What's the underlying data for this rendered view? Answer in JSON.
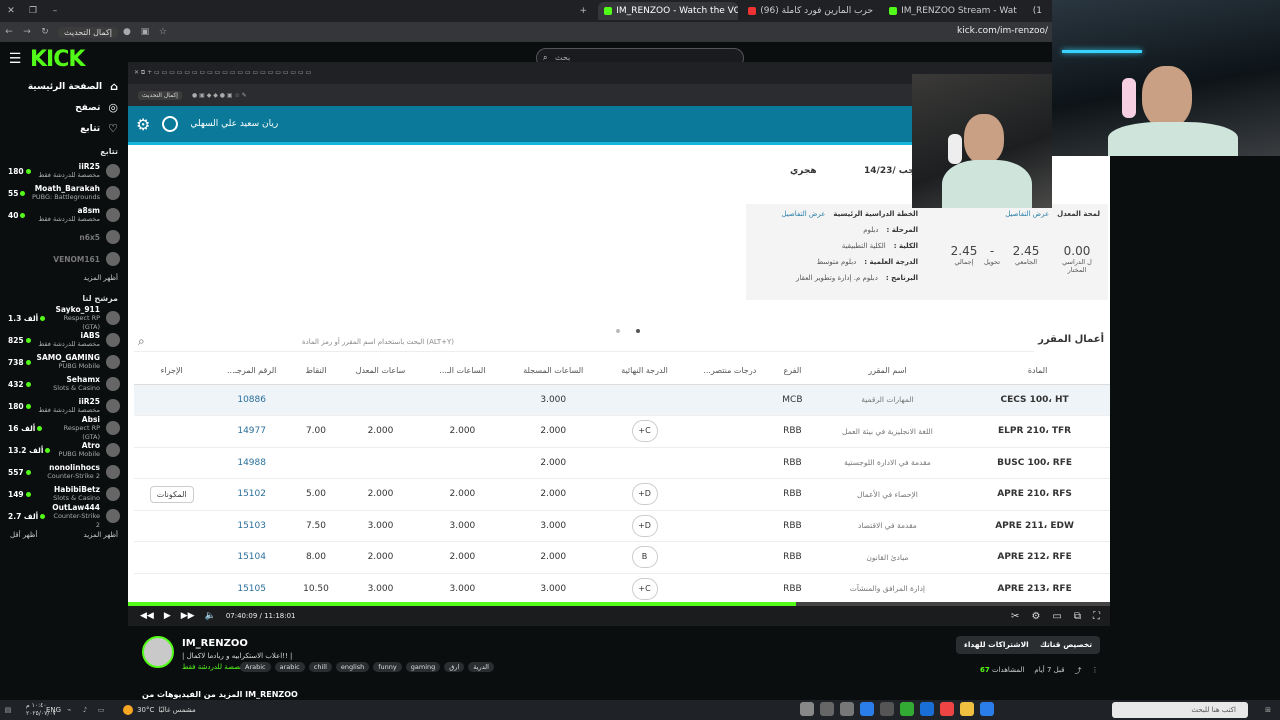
{
  "browser": {
    "tabs": [
      {
        "label": "IM_RENZOO - Watch the VOD",
        "active": true
      },
      {
        "label": "(96) حرب المارين فورد كاملة"
      },
      {
        "label": "IM_RENZOO Stream - Wat"
      },
      {
        "label": "(1"
      }
    ],
    "update_button": "إكمال التحديث",
    "url": "kick.com/im-renzoo/"
  },
  "kick": {
    "logo": "KICK",
    "search_placeholder": "بحث"
  },
  "sidebar": {
    "nav": [
      {
        "label": "الصفحة الرئيسية",
        "icon": "home-icon"
      },
      {
        "label": "تصفح",
        "icon": "compass-icon"
      },
      {
        "label": "تتابع",
        "icon": "heart-icon"
      }
    ],
    "following_title": "تتابع",
    "following": [
      {
        "name": "iiR25",
        "game": "مخصصة للدردشة فقط",
        "viewers": "180"
      },
      {
        "name": "Moath_Barakah",
        "game": "PUBG: Battlegrounds",
        "viewers": "55"
      },
      {
        "name": "a8sm",
        "game": "مخصصة للدردشة فقط",
        "viewers": "40"
      },
      {
        "name": "n6x5",
        "game": "",
        "viewers": "",
        "offline": true
      },
      {
        "name": "VENOM161",
        "game": "",
        "viewers": "",
        "offline": true
      }
    ],
    "show_more_1": "أظهر المزيد",
    "recommended_title": "مرشح لنا",
    "recommended": [
      {
        "name": "Sayko_911",
        "game": "Respect RP (GTA)",
        "viewers": "1.3 ألف"
      },
      {
        "name": "iABS",
        "game": "مخصصة للدردشة فقط",
        "viewers": "825"
      },
      {
        "name": "SAMO_GAMING",
        "game": "PUBG Mobile",
        "viewers": "738"
      },
      {
        "name": "Sehamx",
        "game": "Slots & Casino",
        "viewers": "432"
      },
      {
        "name": "iiR25",
        "game": "مخصصة للدردشة فقط",
        "viewers": "180"
      },
      {
        "name": "Absi",
        "game": "Respect RP (GTA)",
        "viewers": "16 ألف"
      },
      {
        "name": "Atro",
        "game": "PUBG Mobile",
        "viewers": "13.2 ألف"
      },
      {
        "name": "nonolinhocs",
        "game": "Counter-Strike 2",
        "viewers": "557"
      },
      {
        "name": "HabibiBetz",
        "game": "Slots & Casino",
        "viewers": "149"
      },
      {
        "name": "OutLaw444",
        "game": "Counter-Strike 2",
        "viewers": "2.7 ألف"
      }
    ],
    "show_more_2": "أظهر المزيد",
    "show_less": "أظهر أقل"
  },
  "portal": {
    "user_name": "ريان سعيد علي السهلي",
    "date_text": "14/رجب /23",
    "date_sub": "هجري",
    "plan": {
      "title": "الخطة الدراسية الرئيسية",
      "details_link": "عرض التفاصيل",
      "rows": [
        {
          "k": "المرحلة :",
          "v": "دبلوم"
        },
        {
          "k": "الكلية :",
          "v": "الكلية التطبيقية"
        },
        {
          "k": "الدرجة العلمية :",
          "v": "دبلوم متوسط"
        },
        {
          "k": "البرنامج :",
          "v": "دبلوم م. إدارة وتطوير العقار"
        }
      ]
    },
    "gpa": {
      "title": "لمحة المعدل",
      "details_link": "عرض التفاصيل",
      "items": [
        {
          "n": "0.00",
          "l": "ل الدراسي المختار"
        },
        {
          "n": "2.45",
          "l": "الجامعي"
        },
        {
          "n": "-",
          "l": "تحويل"
        },
        {
          "n": "2.45",
          "l": "إجمالي"
        }
      ]
    },
    "section_title": "أعمال المقرر",
    "table_search_placeholder": "البحث باستخدام اسم المقرر أو رمز المادة (ALT+Y)",
    "columns": [
      "المادة",
      "اسم المقرر",
      "الفرع",
      "درجات منتصر...",
      "الدرجة النهائية",
      "الساعات المسجلة",
      "الساعات الـ...",
      "ساعات المعدل",
      "النقاط",
      "الرقم المرجـ...",
      "الإجراء"
    ],
    "rows": [
      {
        "code": "CECS 100، HT",
        "name": "المهارات الرقمية",
        "branch": "MCB",
        "mid": "",
        "grade": "",
        "reg": "3.000",
        "earned": "",
        "gpa_h": "",
        "points": "",
        "ref": "10886",
        "action": ""
      },
      {
        "code": "ELPR 210، TFR",
        "name": "اللغة الانجليزية في بيئة العمل",
        "branch": "RBB",
        "mid": "",
        "grade": "C+",
        "reg": "2.000",
        "earned": "2.000",
        "gpa_h": "2.000",
        "points": "7.00",
        "ref": "14977",
        "action": ""
      },
      {
        "code": "BUSC 100، RFE",
        "name": "مقدمة في الادارة اللوجستية",
        "branch": "RBB",
        "mid": "",
        "grade": "",
        "reg": "2.000",
        "earned": "",
        "gpa_h": "",
        "points": "",
        "ref": "14988",
        "action": ""
      },
      {
        "code": "APRE 210، RFS",
        "name": "الإحصاء في الأعمال",
        "branch": "RBB",
        "mid": "",
        "grade": "D+",
        "reg": "2.000",
        "earned": "2.000",
        "gpa_h": "2.000",
        "points": "5.00",
        "ref": "15102",
        "action": "المكونات"
      },
      {
        "code": "APRE 211، EDW",
        "name": "مقدمة في الاقتصاد",
        "branch": "RBB",
        "mid": "",
        "grade": "D+",
        "reg": "3.000",
        "earned": "3.000",
        "gpa_h": "3.000",
        "points": "7.50",
        "ref": "15103",
        "action": ""
      },
      {
        "code": "APRE 212، RFE",
        "name": "مبادئ القانون",
        "branch": "RBB",
        "mid": "",
        "grade": "B",
        "reg": "2.000",
        "earned": "2.000",
        "gpa_h": "2.000",
        "points": "8.00",
        "ref": "15104",
        "action": ""
      },
      {
        "code": "APRE 213، RFE",
        "name": "إدارة المرافق والمنشآت",
        "branch": "RBB",
        "mid": "",
        "grade": "C+",
        "reg": "3.000",
        "earned": "3.000",
        "gpa_h": "3.000",
        "points": "10.50",
        "ref": "15105",
        "action": ""
      }
    ]
  },
  "player": {
    "time": "07:40:09 / 11:18:01",
    "progress_fraction": 0.68
  },
  "stream": {
    "channel": "IM_RENZOO",
    "title": "| اعلاب الاستكرابيه و ربادما لاكمال!! |",
    "category": "مخصصة للدردشة فقط",
    "tags": [
      "Arabic",
      "arabic",
      "chill",
      "english",
      "funny",
      "gaming",
      "ارق",
      "الدرية"
    ],
    "more_videos": "المزيد من الفيديوهات من IM_RENZOO",
    "subscribe_btn": "الاشتراكات للهداء",
    "custom_btn": "تخصيص قناتك",
    "views_label": "المشاهدات",
    "views": "67",
    "ago": "قبل 7 أيام"
  },
  "taskbar": {
    "weather_temp": "30°C",
    "weather_text": "مشمس غالبًا",
    "lang": "ENG",
    "time": "١٠:٤٠ م",
    "date": "٢٠٢٥/٠٧/٠٧",
    "search_placeholder": "اكتب هنا للبحث"
  },
  "colors": {
    "kick_green": "#53fc18",
    "portal_teal": "#0b7a9a"
  }
}
